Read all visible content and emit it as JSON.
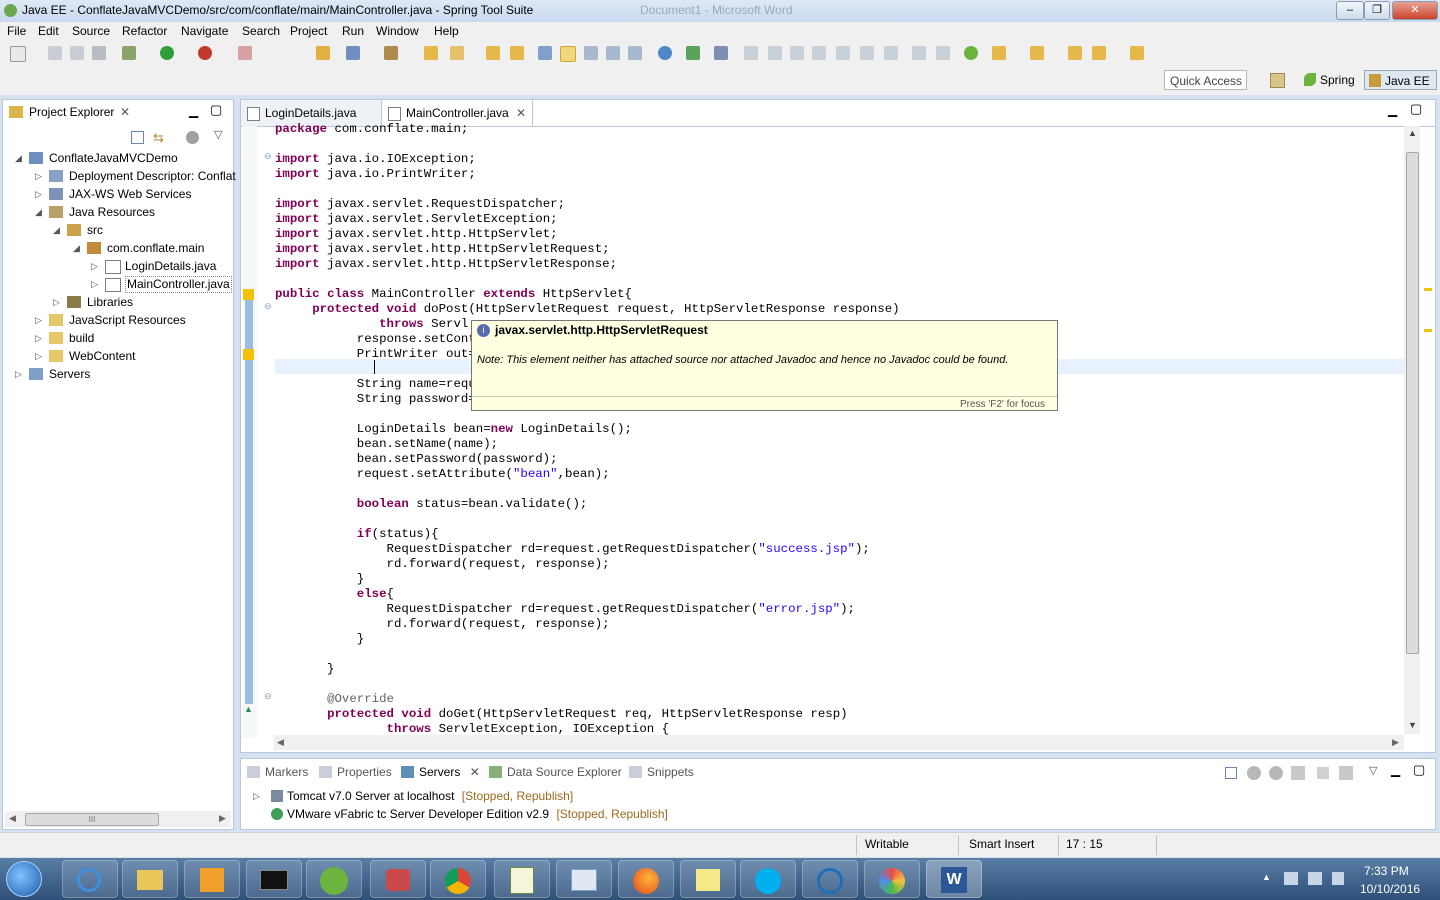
{
  "window": {
    "title": "Java EE - ConflateJavaMVCDemo/src/com/conflate/main/MainController.java - Spring Tool Suite",
    "background_title": "Document1 - Microsoft Word",
    "minimize": "–",
    "maximize": "❐",
    "close": "✕"
  },
  "menu": [
    "File",
    "Edit",
    "Source",
    "Refactor",
    "Navigate",
    "Search",
    "Project",
    "Run",
    "Window",
    "Help"
  ],
  "perspective": {
    "quick_access": "Quick Access",
    "spring": "Spring",
    "javaee": "Java EE"
  },
  "explorer": {
    "tab": "Project Explorer",
    "items": [
      {
        "label": "ConflateJavaMVCDemo"
      },
      {
        "label": "Deployment Descriptor: Conflat"
      },
      {
        "label": "JAX-WS Web Services"
      },
      {
        "label": "Java Resources"
      },
      {
        "label": "src"
      },
      {
        "label": "com.conflate.main"
      },
      {
        "label": "LoginDetails.java"
      },
      {
        "label": "MainController.java"
      },
      {
        "label": "Libraries"
      },
      {
        "label": "JavaScript Resources"
      },
      {
        "label": "build"
      },
      {
        "label": "WebContent"
      },
      {
        "label": "Servers"
      }
    ],
    "scroll_mark": "III"
  },
  "editor": {
    "tabs": [
      {
        "label": "LoginDetails.java"
      },
      {
        "label": "MainController.java"
      }
    ],
    "code_lines": [
      "package com.conflate.main;",
      "",
      "import java.io.IOException;",
      "import java.io.PrintWriter;",
      "",
      "import javax.servlet.RequestDispatcher;",
      "import javax.servlet.ServletException;",
      "import javax.servlet.http.HttpServlet;",
      "import javax.servlet.http.HttpServletRequest;",
      "import javax.servlet.http.HttpServletResponse;",
      "",
      "public class MainController extends HttpServlet{",
      "     protected void doPost(HttpServletRequest request, HttpServletResponse response)",
      "              throws Servl",
      "           response.setCont",
      "           PrintWriter out=",
      "",
      "           String name=requ",
      "           String password=",
      "",
      "           LoginDetails bean=new LoginDetails();",
      "           bean.setName(name);",
      "           bean.setPassword(password);",
      "           request.setAttribute(\"bean\",bean);",
      "",
      "           boolean status=bean.validate();",
      "",
      "           if(status){",
      "               RequestDispatcher rd=request.getRequestDispatcher(\"success.jsp\");",
      "               rd.forward(request, response);",
      "           }",
      "           else{",
      "               RequestDispatcher rd=request.getRequestDispatcher(\"error.jsp\");",
      "               rd.forward(request, response);",
      "           }",
      "",
      "       }",
      "",
      "       @Override",
      "       protected void doGet(HttpServletRequest req, HttpServletResponse resp)",
      "               throws ServletException, IOException {"
    ],
    "tooltip": {
      "title": "javax.servlet.http.HttpServletRequest",
      "note": "Note: This element neither has attached source nor attached Javadoc and hence no Javadoc could be found.",
      "footer": "Press 'F2' for focus"
    }
  },
  "bottom": {
    "tabs": [
      {
        "label": "Markers"
      },
      {
        "label": "Properties"
      },
      {
        "label": "Servers"
      },
      {
        "label": "Data Source Explorer"
      },
      {
        "label": "Snippets"
      }
    ],
    "servers": [
      {
        "name": "Tomcat v7.0 Server at localhost",
        "status": "[Stopped, Republish]"
      },
      {
        "name": "VMware vFabric tc Server Developer Edition v2.9",
        "status": "[Stopped, Republish]"
      }
    ]
  },
  "status": {
    "writable": "Writable",
    "insert": "Smart Insert",
    "position": "17 : 15"
  },
  "taskbar": {
    "time": "7:33 PM",
    "date": "10/10/2016"
  }
}
